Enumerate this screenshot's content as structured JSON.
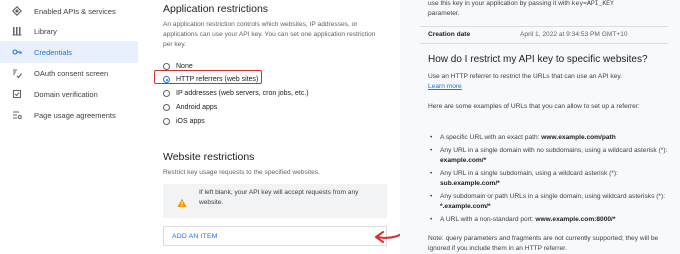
{
  "sidebar": {
    "items": [
      {
        "label": "Enabled APIs & services",
        "icon": "diamond-icon"
      },
      {
        "label": "Library",
        "icon": "library-icon"
      },
      {
        "label": "Credentials",
        "icon": "key-icon",
        "active": true
      },
      {
        "label": "OAuth consent screen",
        "icon": "consent-icon"
      },
      {
        "label": "Domain verification",
        "icon": "checkbox-icon"
      },
      {
        "label": "Page usage agreements",
        "icon": "settings-list-icon"
      }
    ]
  },
  "main": {
    "app_restrictions_title": "Application restrictions",
    "app_restrictions_desc": "An application restriction controls which websites, IP addresses, or applications can use your API key. You can set one application restriction per key.",
    "options": [
      {
        "label": "None"
      },
      {
        "label": "HTTP referrers (web sites)",
        "selected": true
      },
      {
        "label": "IP addresses (web servers, cron jobs, etc.)"
      },
      {
        "label": "Android apps"
      },
      {
        "label": "iOS apps"
      }
    ],
    "website_title": "Website restrictions",
    "website_desc": "Restrict key usage requests to the specified websites.",
    "warning_text": "If left blank, your API key will accept requests from any website.",
    "add_item_label": "ADD AN ITEM"
  },
  "right": {
    "intro_prefix": "use this key in your application by passing it with ",
    "intro_code": "key=API_KEY",
    "intro_suffix": "parameter.",
    "creation_date_label": "Creation date",
    "creation_date_value": "April 1, 2022 at 9:34:53 PM GMT+10",
    "question_title": "How do I restrict my API key to specific websites?",
    "question_desc": "Use an HTTP referrer to restrict the URLs that can use an API key.",
    "learn_more": "Learn more",
    "examples_intro": "Here are some examples of URLs that you can allow to set up a referrer:",
    "bullets": [
      {
        "text": "A specific URL with an exact path: ",
        "bold": "www.example.com/path"
      },
      {
        "text": "Any URL in a single domain with no subdomains, using a wildcard asterisk (*): ",
        "bold": "example.com/*"
      },
      {
        "text": "Any URL in a single subdomain, using a wildcard asterisk (*): ",
        "bold": "sub.example.com/*"
      },
      {
        "text": "Any subdomain or path URLs in a single domain, using wildcard asterisks (*): ",
        "bold": "*.example.com/*"
      },
      {
        "text": "A URL with a non-standard port: ",
        "bold": "www.example.com:8000/*"
      }
    ],
    "note": "Note: query parameters and fragments are not currently supported; they will be ignored if you include them in an HTTP referrer."
  },
  "colors": {
    "accent": "#1a73e8",
    "highlight": "#d32f2f",
    "warning": "#f29900"
  }
}
